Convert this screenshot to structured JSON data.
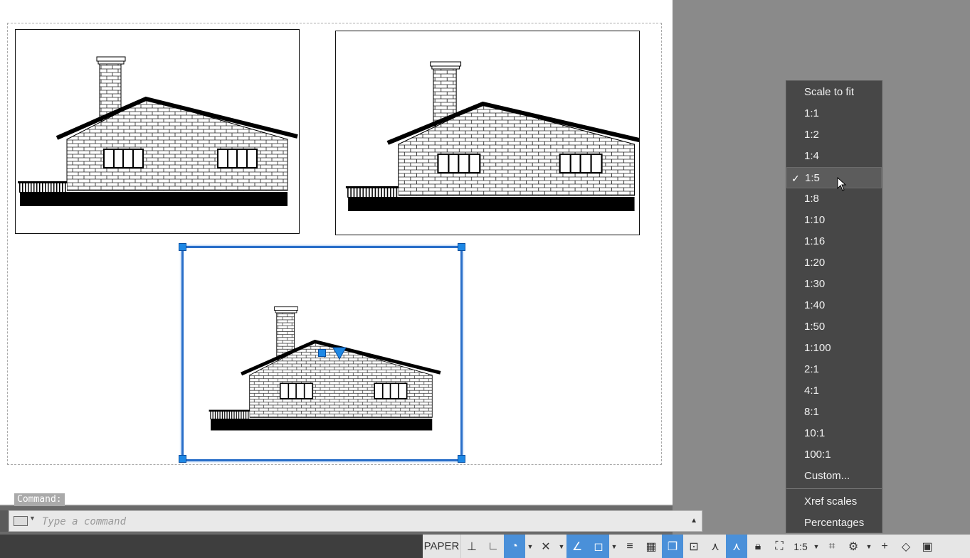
{
  "command_line": {
    "label": "Command:",
    "placeholder": "Type a command"
  },
  "status_bar": {
    "space_button": "PAPER",
    "scale_value": "1:5"
  },
  "scale_menu": {
    "items": [
      "Scale to fit",
      "1:1",
      "1:2",
      "1:4",
      "1:5",
      "1:8",
      "1:10",
      "1:16",
      "1:20",
      "1:30",
      "1:40",
      "1:50",
      "1:100",
      "2:1",
      "4:1",
      "8:1",
      "10:1",
      "100:1",
      "Custom..."
    ],
    "selected": "1:5",
    "extra_items": [
      "Xref scales",
      "Percentages"
    ]
  },
  "colors": {
    "selection_blue": "#2a6fc9",
    "grip_blue": "#1e88e5",
    "menu_background": "#474747",
    "status_active": "#4a90d9"
  }
}
